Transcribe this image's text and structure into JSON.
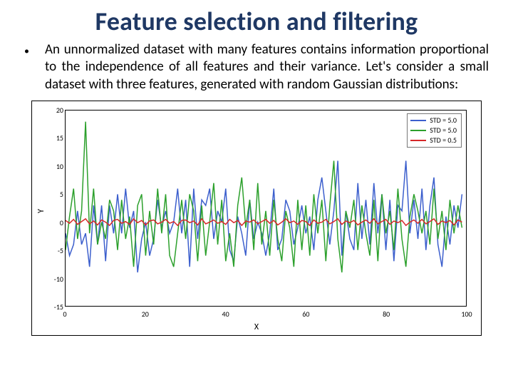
{
  "title": "Feature selection and filtering",
  "body": "An unnormalized dataset with many features contains information proportional to the independence of all features and their variance. Let's consider a small dataset with three features, generated with random Gaussian distributions:",
  "chart_data": {
    "type": "line",
    "title": "",
    "xlabel": "X",
    "ylabel": "Y",
    "xlim": [
      0,
      100
    ],
    "ylim": [
      -15,
      20
    ],
    "xticks": [
      0,
      20,
      40,
      60,
      80,
      100
    ],
    "yticks": [
      -15,
      -10,
      -5,
      0,
      5,
      10,
      15,
      20
    ],
    "legend_position": "upper right",
    "series": [
      {
        "name": "STD = 5.0",
        "color": "#3c5fcd",
        "x": [
          0,
          1,
          2,
          3,
          4,
          5,
          6,
          7,
          8,
          9,
          10,
          11,
          12,
          13,
          14,
          15,
          16,
          17,
          18,
          19,
          20,
          21,
          22,
          23,
          24,
          25,
          26,
          27,
          28,
          29,
          30,
          31,
          32,
          33,
          34,
          35,
          36,
          37,
          38,
          39,
          40,
          41,
          42,
          43,
          44,
          45,
          46,
          47,
          48,
          49,
          50,
          51,
          52,
          53,
          54,
          55,
          56,
          57,
          58,
          59,
          60,
          61,
          62,
          63,
          64,
          65,
          66,
          67,
          68,
          69,
          70,
          71,
          72,
          73,
          74,
          75,
          76,
          77,
          78,
          79,
          80,
          81,
          82,
          83,
          84,
          85,
          86,
          87,
          88,
          89,
          90,
          91,
          92,
          93,
          94,
          95,
          96,
          97,
          98,
          99
        ],
        "values": [
          -2,
          -6,
          -4,
          2,
          -4,
          -2,
          -8,
          3,
          -4,
          3,
          -7,
          3,
          -2,
          5,
          -2,
          6,
          -1,
          2,
          -9,
          -3,
          0,
          -6,
          -3,
          4,
          -1,
          2,
          -2,
          0,
          6,
          -2,
          4,
          -8,
          6,
          -3,
          4,
          3,
          6,
          -3,
          2,
          0,
          6,
          -5,
          -7,
          1,
          -2,
          -6,
          4,
          -3,
          0,
          -2,
          -6,
          -2,
          6,
          -5,
          -3,
          4,
          2,
          -4,
          -1,
          3,
          -2,
          1,
          -5,
          4,
          8,
          2,
          -4,
          2,
          11,
          -6,
          2,
          -3,
          -5,
          7,
          -3,
          4,
          -4,
          7,
          -2,
          5,
          -5,
          4,
          -7,
          3,
          2,
          11,
          -2,
          4,
          -3,
          6,
          -5,
          3,
          8,
          -4,
          -8,
          1,
          -4,
          3,
          -1,
          5
        ]
      },
      {
        "name": "STD = 5.0",
        "color": "#2ca02c",
        "x": [
          0,
          1,
          2,
          3,
          4,
          5,
          6,
          7,
          8,
          9,
          10,
          11,
          12,
          13,
          14,
          15,
          16,
          17,
          18,
          19,
          20,
          21,
          22,
          23,
          24,
          25,
          26,
          27,
          28,
          29,
          30,
          31,
          32,
          33,
          34,
          35,
          36,
          37,
          38,
          39,
          40,
          41,
          42,
          43,
          44,
          45,
          46,
          47,
          48,
          49,
          50,
          51,
          52,
          53,
          54,
          55,
          56,
          57,
          58,
          59,
          60,
          61,
          62,
          63,
          64,
          65,
          66,
          67,
          68,
          69,
          70,
          71,
          72,
          73,
          74,
          75,
          76,
          77,
          78,
          79,
          80,
          81,
          82,
          83,
          84,
          85,
          86,
          87,
          88,
          89,
          90,
          91,
          92,
          93,
          94,
          95,
          96,
          97,
          98,
          99
        ],
        "values": [
          -5,
          1,
          6,
          -3,
          2,
          18,
          -2,
          6,
          -4,
          0,
          -3,
          4,
          2,
          -5,
          4,
          -3,
          1,
          -8,
          3,
          5,
          -6,
          2,
          -4,
          6,
          -2,
          5,
          -6,
          -8,
          -2,
          4,
          -3,
          5,
          2,
          -7,
          3,
          -6,
          0,
          7,
          -4,
          4,
          -7,
          -2,
          -8,
          3,
          8,
          -1,
          4,
          -5,
          7,
          -4,
          2,
          -6,
          4,
          -3,
          -7,
          2,
          -1,
          -8,
          4,
          -5,
          3,
          -6,
          5,
          -2,
          4,
          -7,
          3,
          11,
          -3,
          -9,
          2,
          -1,
          4,
          -5,
          3,
          -2,
          -6,
          4,
          -7,
          5,
          -2,
          2,
          -5,
          6,
          -3,
          -8,
          1,
          5,
          2,
          -2,
          2,
          -4,
          6,
          -3,
          2,
          -5,
          4,
          -2,
          3,
          -1
        ]
      },
      {
        "name": "STD = 0.5",
        "color": "#d62728",
        "x": [
          0,
          1,
          2,
          3,
          4,
          5,
          6,
          7,
          8,
          9,
          10,
          11,
          12,
          13,
          14,
          15,
          16,
          17,
          18,
          19,
          20,
          21,
          22,
          23,
          24,
          25,
          26,
          27,
          28,
          29,
          30,
          31,
          32,
          33,
          34,
          35,
          36,
          37,
          38,
          39,
          40,
          41,
          42,
          43,
          44,
          45,
          46,
          47,
          48,
          49,
          50,
          51,
          52,
          53,
          54,
          55,
          56,
          57,
          58,
          59,
          60,
          61,
          62,
          63,
          64,
          65,
          66,
          67,
          68,
          69,
          70,
          71,
          72,
          73,
          74,
          75,
          76,
          77,
          78,
          79,
          80,
          81,
          82,
          83,
          84,
          85,
          86,
          87,
          88,
          89,
          90,
          91,
          92,
          93,
          94,
          95,
          96,
          97,
          98,
          99
        ],
        "values": [
          0.3,
          -0.2,
          0.5,
          -0.4,
          0.1,
          0.6,
          -0.3,
          0.2,
          -0.5,
          0.4,
          0.0,
          -0.6,
          0.3,
          0.5,
          -0.2,
          0.1,
          -0.4,
          0.6,
          -0.1,
          0.3,
          -0.5,
          0.2,
          0.4,
          -0.3,
          0.0,
          0.5,
          -0.2,
          0.1,
          -0.6,
          0.3,
          0.4,
          -0.1,
          0.2,
          -0.5,
          0.6,
          -0.3,
          0.0,
          0.4,
          -0.2,
          0.1,
          -0.4,
          0.5,
          -0.1,
          0.3,
          -0.6,
          0.2,
          0.0,
          0.4,
          -0.3,
          0.1,
          0.5,
          -0.2,
          0.3,
          -0.5,
          0.0,
          0.6,
          -0.1,
          0.2,
          -0.4,
          0.3,
          0.1,
          -0.6,
          0.4,
          -0.2,
          0.0,
          0.5,
          -0.3,
          0.1,
          0.6,
          -0.4,
          0.2,
          -0.1,
          0.3,
          -0.5,
          0.0,
          0.4,
          -0.2,
          0.6,
          -0.3,
          0.1,
          0.5,
          -0.4,
          0.2,
          -0.1,
          0.3,
          -0.6,
          0.0,
          0.4,
          -0.2,
          0.5,
          -0.3,
          0.1,
          0.6,
          -0.4,
          0.2,
          -0.1,
          0.3,
          -0.5,
          0.4,
          0.0
        ]
      }
    ]
  }
}
